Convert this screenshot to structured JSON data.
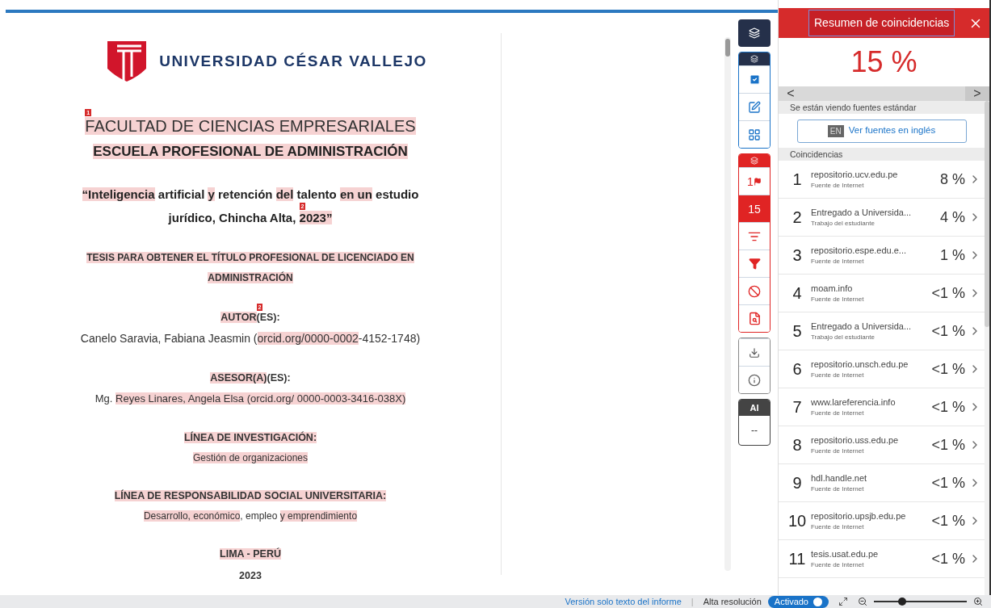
{
  "document": {
    "logo_text": "UNIVERSIDAD CÉSAR VALLEJO",
    "blocks": [
      {
        "lines": [
          {
            "kind": "faculty",
            "segments": [
              {
                "text": "FACULTAD DE CIENCIAS EMPRESARIALES",
                "highlighted": true,
                "marker": "1"
              }
            ]
          },
          {
            "kind": "school",
            "segments": [
              {
                "text": "ESCUELA PROFESIONAL DE ADMINISTRACIÓN",
                "highlighted": true
              }
            ]
          }
        ]
      },
      {
        "lines": [
          {
            "kind": "title",
            "segments": [
              {
                "text": "“Inteligencia",
                "highlighted": true
              },
              {
                "text": " artificial ",
                "highlighted": false
              },
              {
                "text": "y",
                "highlighted": true
              },
              {
                "text": " retención ",
                "highlighted": false
              },
              {
                "text": "del",
                "highlighted": true
              },
              {
                "text": " talento ",
                "highlighted": false
              },
              {
                "text": "en un",
                "highlighted": true
              },
              {
                "text": " estudio",
                "highlighted": false
              }
            ]
          },
          {
            "kind": "title",
            "segments": [
              {
                "text": "jurídico, Chincha Alta, ",
                "highlighted": false
              },
              {
                "text": "2023”",
                "highlighted": true,
                "marker": "2"
              }
            ]
          }
        ]
      },
      {
        "lines": [
          {
            "kind": "caption",
            "segments": [
              {
                "text": "TESIS PARA OBTENER EL TÍTULO PROFESIONAL DE LICENCIADO EN",
                "highlighted": true
              }
            ]
          },
          {
            "kind": "caption",
            "segments": [
              {
                "text": "ADMINISTRACIÓN",
                "highlighted": true
              }
            ]
          }
        ]
      },
      {
        "lines": [
          {
            "kind": "label",
            "segments": [
              {
                "text": "AUTOR",
                "highlighted": true
              },
              {
                "text": "(ES):",
                "highlighted": false,
                "marker": "2"
              }
            ]
          },
          {
            "kind": "body",
            "segments": [
              {
                "text": "Canelo Saravia, Fabiana Jeasmin (",
                "highlighted": false
              },
              {
                "text": "orcid.org/0000-0002",
                "highlighted": true
              },
              {
                "text": "-4152-1748)",
                "highlighted": false
              }
            ]
          }
        ]
      },
      {
        "lines": [
          {
            "kind": "label",
            "segments": [
              {
                "text": "ASESOR(A)",
                "highlighted": true
              },
              {
                "text": "(ES):",
                "highlighted": false
              }
            ]
          },
          {
            "kind": "small",
            "segments": [
              {
                "text": "Mg. ",
                "highlighted": false
              },
              {
                "text": "Reyes Linares, Angela Elsa (orcid.org/ 0000-0003-3416-038X)",
                "highlighted": true
              }
            ]
          }
        ]
      },
      {
        "lines": [
          {
            "kind": "label",
            "segments": [
              {
                "text": "LÍNEA DE INVESTIGACIÓN:",
                "highlighted": true
              }
            ]
          },
          {
            "kind": "tiny",
            "segments": [
              {
                "text": "Gestión de organizaciones",
                "highlighted": true
              }
            ]
          }
        ]
      },
      {
        "lines": [
          {
            "kind": "label",
            "segments": [
              {
                "text": "LÍNEA DE RESPONSABILIDAD SOCIAL UNIVERSITARIA:",
                "highlighted": true
              }
            ]
          },
          {
            "kind": "tiny",
            "segments": [
              {
                "text": "Desarrollo, económico",
                "highlighted": true
              },
              {
                "text": ", empleo ",
                "highlighted": false
              },
              {
                "text": "y emprendimiento",
                "highlighted": true
              }
            ]
          }
        ]
      },
      {
        "lines": [
          {
            "kind": "label",
            "segments": [
              {
                "text": "LIMA - PERÚ",
                "highlighted": true
              }
            ]
          },
          {
            "kind": "label",
            "segments": [
              {
                "text": "2023",
                "highlighted": false
              }
            ]
          }
        ]
      }
    ]
  },
  "toolbar": {
    "groups": [
      {
        "kind": "layers",
        "items": [
          {
            "kind": "check",
            "selected": false
          },
          {
            "kind": "edit",
            "selected": false
          },
          {
            "kind": "grid",
            "selected": false
          }
        ]
      },
      {
        "kind": "matches",
        "items": [
          {
            "kind": "flag",
            "label": "1",
            "selected": false
          },
          {
            "kind": "count",
            "label": "15",
            "selected": true
          },
          {
            "kind": "sort",
            "selected": false
          },
          {
            "kind": "filter",
            "selected": false
          },
          {
            "kind": "ban",
            "selected": false
          },
          {
            "kind": "search",
            "selected": false
          }
        ]
      },
      {
        "kind": "plain",
        "items": [
          {
            "kind": "download",
            "selected": false
          },
          {
            "kind": "info",
            "selected": false
          }
        ]
      }
    ],
    "ai": {
      "label": "AI",
      "value": "--"
    }
  },
  "panel": {
    "title": "Resumen de coincidencias",
    "score": "15 %",
    "nav_left": "<",
    "nav_right": ">",
    "notice": "Se están viendo fuentes estándar",
    "lang_badge": "EN",
    "lang_button": "Ver fuentes en inglés",
    "section": "Coincidencias",
    "matches": [
      {
        "rank": "1",
        "source": "repositorio.ucv.edu.pe",
        "type": "Fuente de Internet",
        "percent": "8 %"
      },
      {
        "rank": "2",
        "source": "Entregado a Universida...",
        "type": "Trabajo del estudiante",
        "percent": "4 %"
      },
      {
        "rank": "3",
        "source": "repositorio.espe.edu.e...",
        "type": "Fuente de Internet",
        "percent": "1 %"
      },
      {
        "rank": "4",
        "source": "moam.info",
        "type": "Fuente de Internet",
        "percent": "<1 %"
      },
      {
        "rank": "5",
        "source": "Entregado a Universida...",
        "type": "Trabajo del estudiante",
        "percent": "<1 %"
      },
      {
        "rank": "6",
        "source": "repositorio.unsch.edu.pe",
        "type": "Fuente de Internet",
        "percent": "<1 %"
      },
      {
        "rank": "7",
        "source": "www.lareferencia.info",
        "type": "Fuente de Internet",
        "percent": "<1 %"
      },
      {
        "rank": "8",
        "source": "repositorio.uss.edu.pe",
        "type": "Fuente de Internet",
        "percent": "<1 %"
      },
      {
        "rank": "9",
        "source": "hdl.handle.net",
        "type": "Fuente de Internet",
        "percent": "<1 %"
      },
      {
        "rank": "10",
        "source": "repositorio.upsjb.edu.pe",
        "type": "Fuente de Internet",
        "percent": "<1 %"
      },
      {
        "rank": "11",
        "source": "tesis.usat.edu.pe",
        "type": "Fuente de Internet",
        "percent": "<1 %"
      }
    ]
  },
  "status_bar": {
    "text_version_link": "Versión solo texto del informe",
    "separator": "|",
    "hires_label": "Alta resolución",
    "hires_toggle": {
      "label": "Activado",
      "on": true
    },
    "zoom": {
      "level": 0.3
    }
  }
}
